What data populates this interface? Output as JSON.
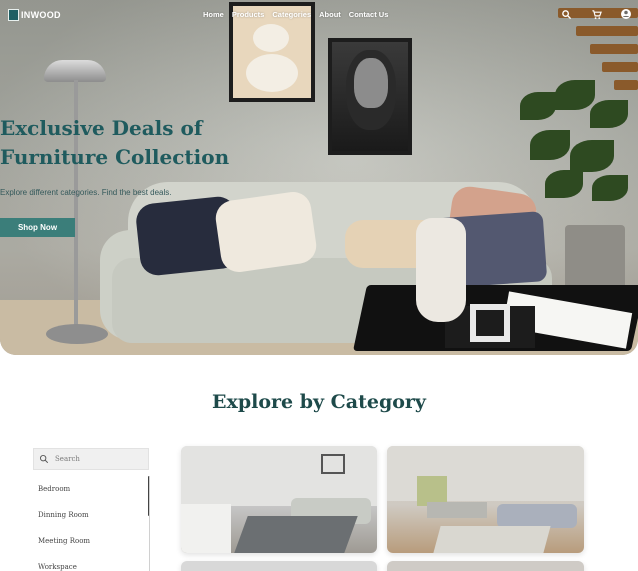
{
  "brand": {
    "name": "INWOOD"
  },
  "nav": {
    "links": [
      "Home",
      "Products",
      "Categories",
      "About",
      "Contact Us"
    ],
    "icons": [
      "search-icon",
      "cart-icon",
      "account-icon"
    ]
  },
  "hero": {
    "title": "Exclusive Deals of Furniture Collection",
    "subtitle": "Explore different categories. Find the best deals.",
    "cta": "Shop Now"
  },
  "categories": {
    "heading": "Explore by Category",
    "search_placeholder": "Search",
    "items": [
      "Bedroom",
      "Dinning Room",
      "Meeting Room",
      "Workspace"
    ]
  },
  "colors": {
    "accent": "#1f5b5e",
    "button": "#3b7e7a"
  }
}
